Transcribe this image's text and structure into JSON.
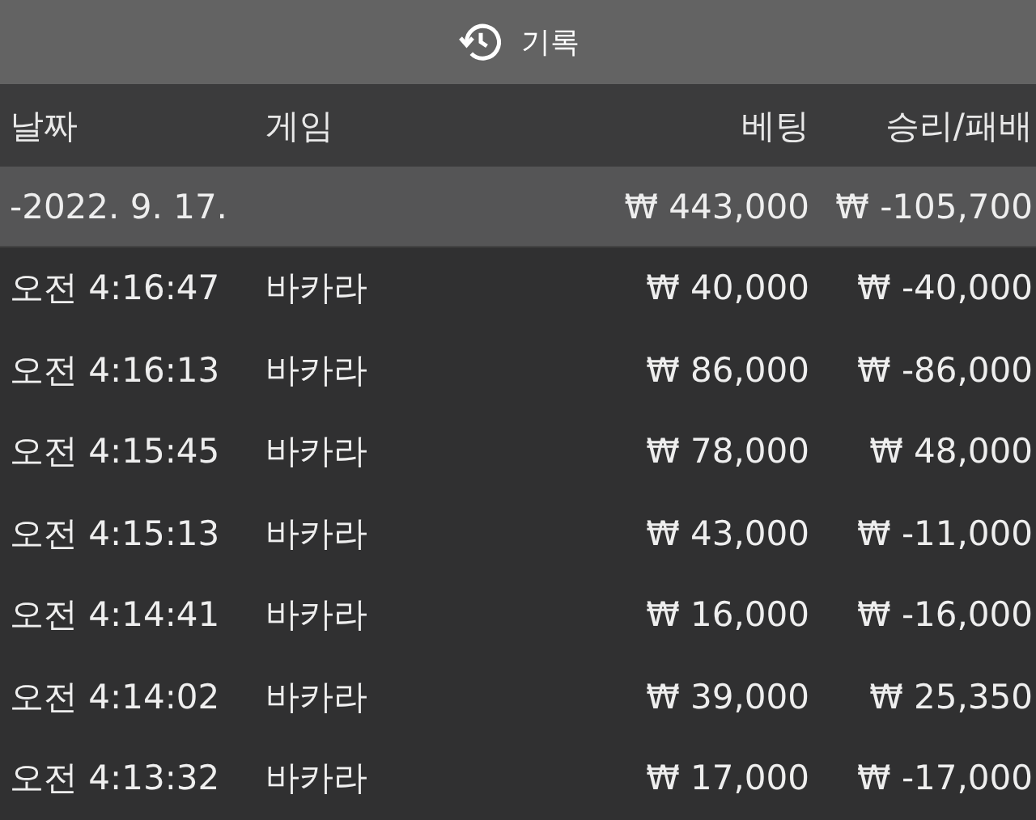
{
  "title_bar": {
    "title": "기록"
  },
  "table": {
    "columns": [
      "날짜",
      "게임",
      "베팅",
      "승리/패배"
    ],
    "group": {
      "date": "-2022. 9. 17.",
      "bet": "₩ 443,000",
      "result": "₩ -105,700"
    },
    "rows": [
      {
        "time": "오전 4:16:47",
        "game": "바카라",
        "bet": "₩ 40,000",
        "result": "₩ -40,000"
      },
      {
        "time": "오전 4:16:13",
        "game": "바카라",
        "bet": "₩ 86,000",
        "result": "₩ -86,000"
      },
      {
        "time": "오전 4:15:45",
        "game": "바카라",
        "bet": "₩ 78,000",
        "result": "₩ 48,000"
      },
      {
        "time": "오전 4:15:13",
        "game": "바카라",
        "bet": "₩ 43,000",
        "result": "₩ -11,000"
      },
      {
        "time": "오전 4:14:41",
        "game": "바카라",
        "bet": "₩ 16,000",
        "result": "₩ -16,000"
      },
      {
        "time": "오전 4:14:02",
        "game": "바카라",
        "bet": "₩ 39,000",
        "result": "₩ 25,350"
      },
      {
        "time": "오전 4:13:32",
        "game": "바카라",
        "bet": "₩ 17,000",
        "result": "₩ -17,000"
      }
    ]
  }
}
